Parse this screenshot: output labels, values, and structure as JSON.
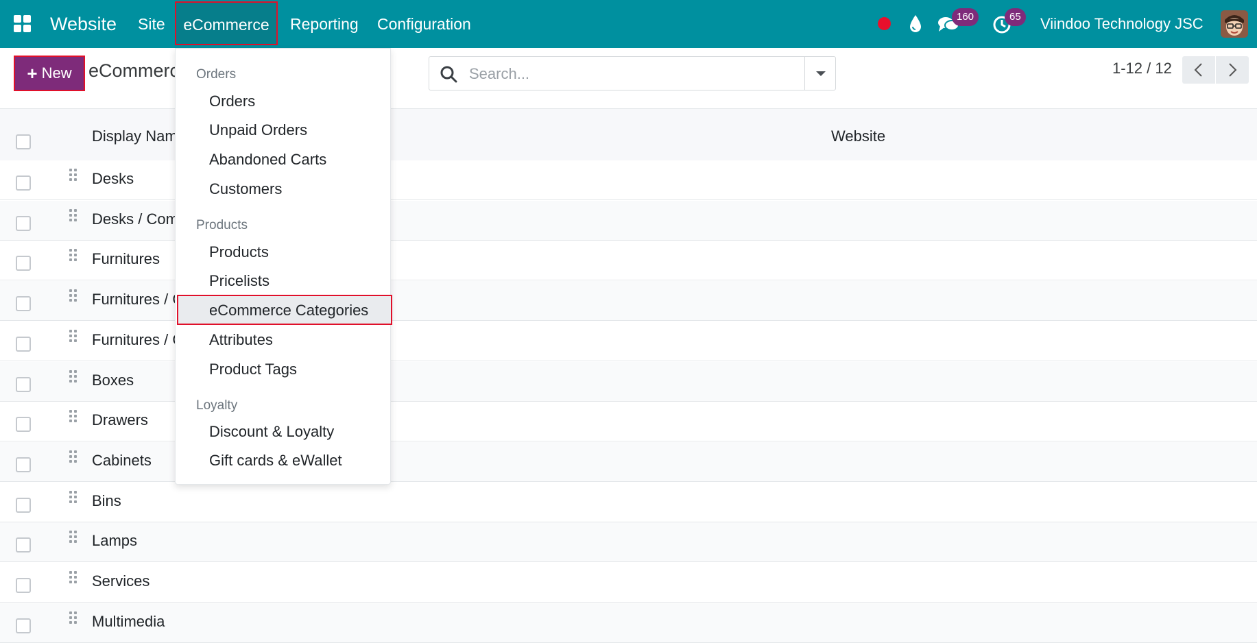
{
  "navbar": {
    "brand": "Website",
    "menus": [
      "Site",
      "eCommerce",
      "Reporting",
      "Configuration"
    ],
    "messages_count": "160",
    "activities_count": "65",
    "company": "Viindoo Technology JSC",
    "color": "#00909f"
  },
  "control_panel": {
    "new_label": "New",
    "title": "eCommerce Categories",
    "search_placeholder": "Search...",
    "pager_value": "1-12 / 12"
  },
  "list": {
    "columns": [
      "Display Name",
      "Website"
    ],
    "rows": [
      "Desks",
      "Desks / Components",
      "Furnitures",
      "Furnitures / Chairs",
      "Furnitures / Couches",
      "Boxes",
      "Drawers",
      "Cabinets",
      "Bins",
      "Lamps",
      "Services",
      "Multimedia"
    ]
  },
  "dropdown": {
    "sections": [
      {
        "title": "Orders",
        "items": [
          "Orders",
          "Unpaid Orders",
          "Abandoned Carts",
          "Customers"
        ]
      },
      {
        "title": "Products",
        "items": [
          "Products",
          "Pricelists",
          "eCommerce Categories",
          "Attributes",
          "Product Tags"
        ]
      },
      {
        "title": "Loyalty",
        "items": [
          "Discount & Loyalty",
          "Gift cards & eWallet"
        ]
      }
    ],
    "active_item": "eCommerce Categories"
  },
  "colors": {
    "primary": "#7e2b7a",
    "highlight_border": "#e0102a"
  }
}
